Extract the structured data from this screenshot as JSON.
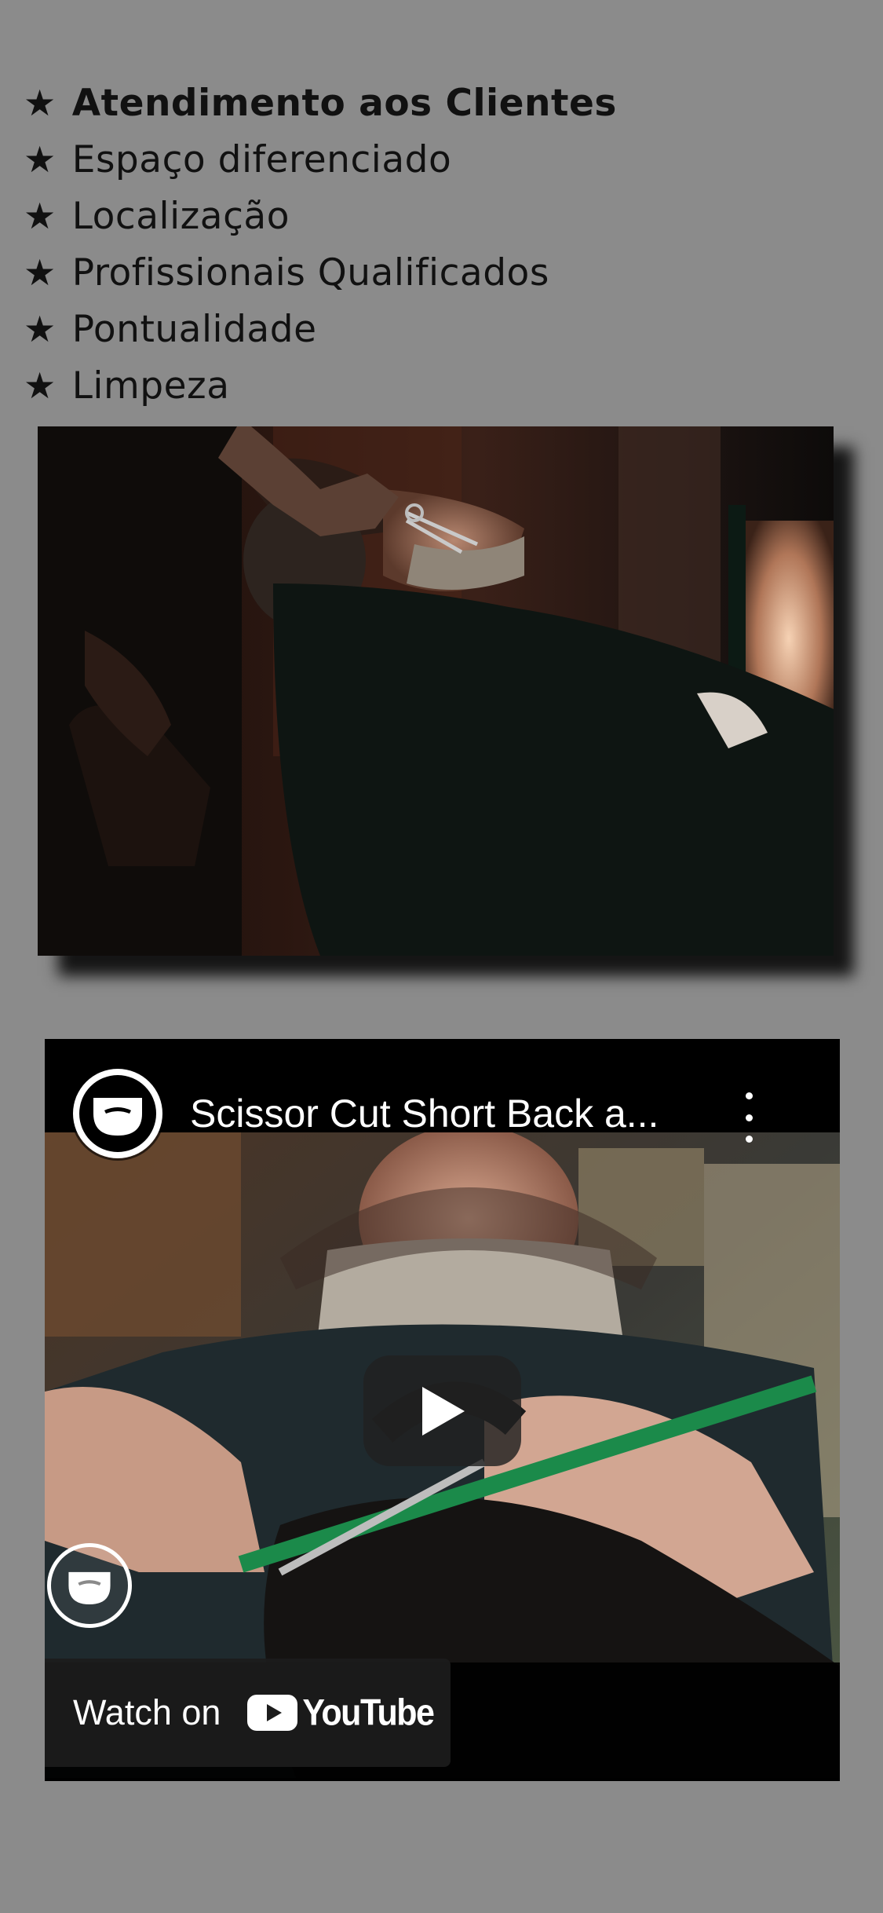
{
  "features": [
    {
      "icon": "star-icon",
      "glyph": "★",
      "label": "Atendimento aos Clientes",
      "bold": true
    },
    {
      "icon": "star-icon",
      "glyph": "★",
      "label": "Espaço diferenciado",
      "bold": false
    },
    {
      "icon": "star-icon",
      "glyph": "★",
      "label": "Localização",
      "bold": false
    },
    {
      "icon": "star-icon",
      "glyph": "★",
      "label": "Profissionais Qualificados",
      "bold": false
    },
    {
      "icon": "star-icon",
      "glyph": "★",
      "label": "Pontualidade",
      "bold": false
    },
    {
      "icon": "star-icon",
      "glyph": "★",
      "label": "Limpeza",
      "bold": false
    }
  ],
  "video": {
    "title": "Scissor Cut Short Back a...",
    "watch_on": "Watch on",
    "youtube": "YouTube",
    "icons": {
      "channel": "beard-logo-icon",
      "more": "more-vertical-icon",
      "play": "play-icon",
      "watermark": "beard-logo-icon",
      "youtube_logo": "youtube-logo-icon"
    }
  },
  "colors": {
    "background": "#8b8b8b",
    "text": "#111111",
    "youtube_red": "#ff0000"
  }
}
